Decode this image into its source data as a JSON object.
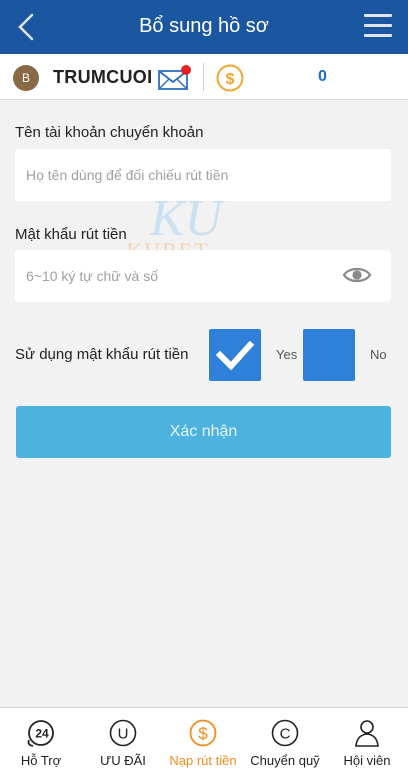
{
  "header": {
    "title": "Bổ sung hồ sơ"
  },
  "user": {
    "avatar_initial": "B",
    "username": "TRUMCUOI",
    "balance": "0"
  },
  "form": {
    "account_name_label": "Tên tài khoản chuyển khoản",
    "account_name_placeholder": "Họ tên dùng để đối chiếu rút tiền",
    "password_label": "Mật khẩu rút tiền",
    "password_placeholder": "6~10 ký tự chữ và số",
    "use_password_label": "Sử dụng mật khẩu rút tiền",
    "option_yes": "Yes",
    "option_no": "No",
    "use_password_selected": "Yes",
    "confirm_label": "Xác nhận"
  },
  "watermark": {
    "monogram": "KU",
    "text": "KUBET"
  },
  "nav": [
    {
      "label": "Hỗ Trợ",
      "icon": "support-24-icon",
      "active": false
    },
    {
      "label": "ƯU ĐÃI",
      "icon": "promotion-u-icon",
      "active": false
    },
    {
      "label": "Nạp rút tiền",
      "icon": "dollar-coin-icon",
      "active": true
    },
    {
      "label": "Chuyển quỹ",
      "icon": "transfer-c-icon",
      "active": false
    },
    {
      "label": "Hội viên",
      "icon": "member-person-icon",
      "active": false
    }
  ],
  "colors": {
    "header_bg": "#1b57a0",
    "checkbox_bg": "#2f80d8",
    "confirm_bg": "#4db3de",
    "active_nav": "#f08c1b",
    "balance": "#1f6fbf"
  }
}
